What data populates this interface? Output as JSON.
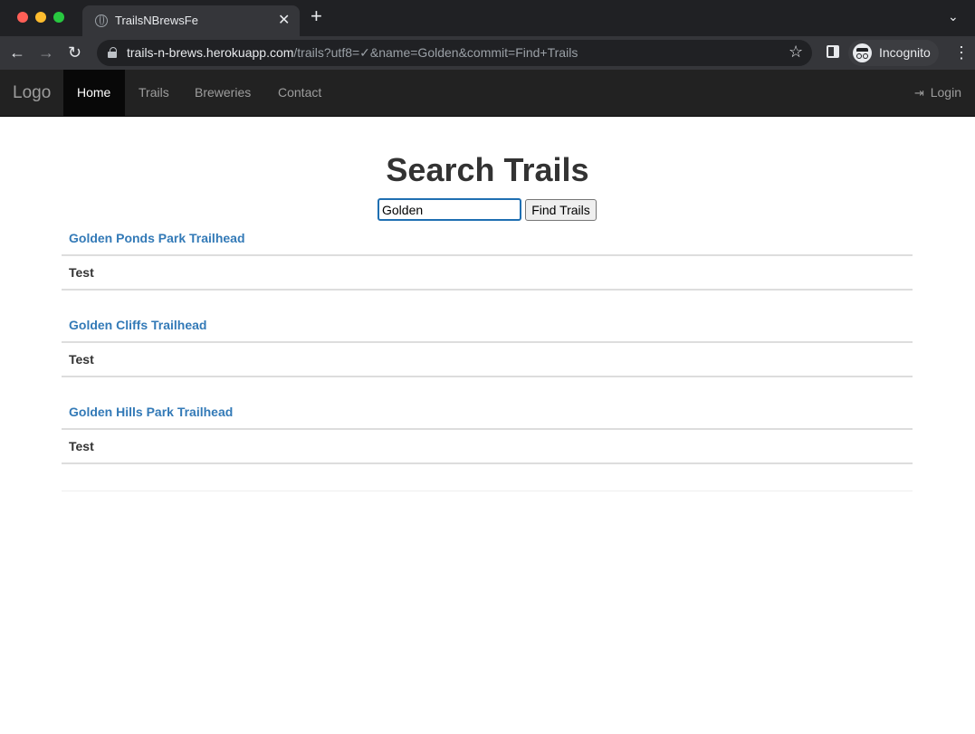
{
  "browser": {
    "tab_title": "TrailsNBrewsFe",
    "close_symbol": "✕",
    "new_tab_symbol": "+",
    "url_host": "trails-n-brews.herokuapp.com",
    "url_path": "/trails?utf8=✓&name=Golden&commit=Find+Trails",
    "incognito_label": "Incognito"
  },
  "navbar": {
    "brand": "Logo",
    "links": [
      "Home",
      "Trails",
      "Breweries",
      "Contact"
    ],
    "active": "Home",
    "login": "Login"
  },
  "search": {
    "title": "Search Trails",
    "value": "Golden",
    "button_label": "Find Trails"
  },
  "results": [
    {
      "name": "Golden Ponds Park Trailhead",
      "description": "Test"
    },
    {
      "name": "Golden Cliffs Trailhead",
      "description": "Test"
    },
    {
      "name": "Golden Hills Park Trailhead",
      "description": "Test"
    }
  ]
}
